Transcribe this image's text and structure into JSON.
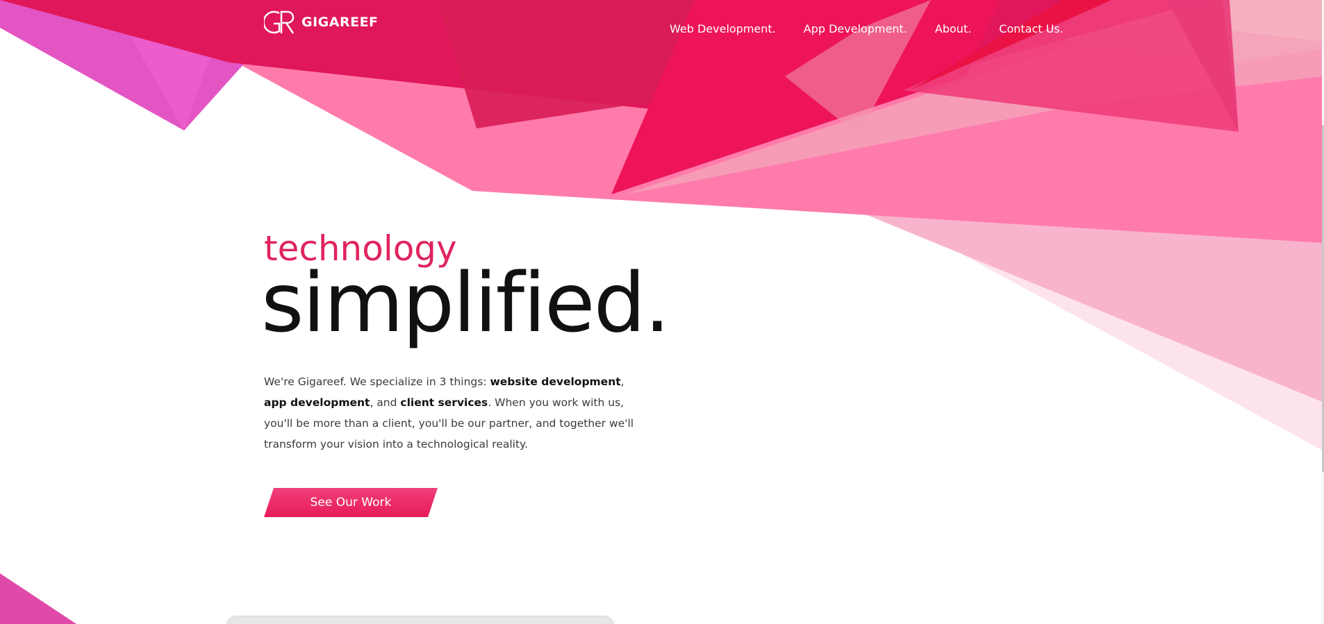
{
  "brand": {
    "name": "GIGAREEF",
    "logo_icon": "gigareef-gr-monogram-icon"
  },
  "nav": {
    "items": [
      {
        "label": "Web Development."
      },
      {
        "label": "App Development."
      },
      {
        "label": "About."
      },
      {
        "label": "Contact Us."
      }
    ]
  },
  "hero": {
    "eyebrow": "technology",
    "headline": "simplified.",
    "intro": {
      "part1": "We're Gigareef. We specialize in 3 things: ",
      "strong1": "website development",
      "part2": ", ",
      "strong2": "app development",
      "part3": ", and ",
      "strong3": "client services",
      "part4": ". When you work with us, you'll be more than a client, you'll be our partner, and together we'll transform your vision into a technological reality."
    },
    "cta_label": "See Our Work"
  },
  "colors": {
    "accent": "#e0245e",
    "pink_light": "#ff7bac",
    "pink_pale": "#f9b6cf",
    "magenta": "#e455c4",
    "crimson": "#e0144f",
    "text_dark": "#111111",
    "text_body": "#3a3a3a"
  }
}
